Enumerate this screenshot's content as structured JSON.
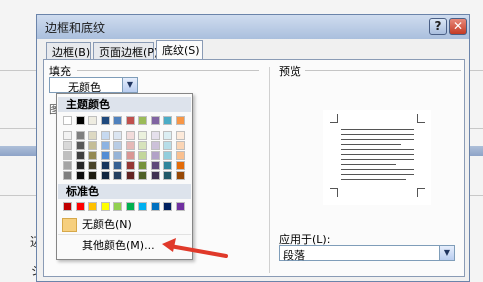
{
  "dialog": {
    "title": "边框和底纹",
    "help_label": "?",
    "close_label": "✕"
  },
  "tabs": [
    {
      "label": "边框(B)"
    },
    {
      "label": "页面边框(P)"
    },
    {
      "label": "底纹(S)"
    }
  ],
  "shading": {
    "fill_label": "填充",
    "fill_value": "无颜色",
    "pattern_label_partial": "图"
  },
  "preview": {
    "label": "预览"
  },
  "apply": {
    "label": "应用于(L):",
    "value": "段落"
  },
  "color_menu": {
    "theme_colors_label": "主题颜色",
    "standard_colors_label": "标准色",
    "no_color_label": "无颜色(N)",
    "more_colors_label": "其他颜色(M)...",
    "theme_top_row": [
      "#ffffff",
      "#000000",
      "#eeece1",
      "#1f497d",
      "#4f81bd",
      "#c0504d",
      "#9bbb59",
      "#8064a2",
      "#4bacc6",
      "#f79646"
    ],
    "theme_shades": [
      [
        "#f2f2f2",
        "#7f7f7f",
        "#ddd9c3",
        "#c6d9f0",
        "#dbe5f1",
        "#f2dcdb",
        "#ebf1dd",
        "#e5e0ec",
        "#dbeef3",
        "#fdeada"
      ],
      [
        "#d8d8d8",
        "#595959",
        "#c4bd97",
        "#8db3e2",
        "#b8cce4",
        "#e5b9b7",
        "#d7e3bc",
        "#ccc1d9",
        "#b7dde8",
        "#fbd5b5"
      ],
      [
        "#bfbfbf",
        "#3f3f3f",
        "#938953",
        "#548dd4",
        "#95b3d7",
        "#d99694",
        "#c3d69b",
        "#b2a2c7",
        "#92cddc",
        "#fac08f"
      ],
      [
        "#a5a5a5",
        "#262626",
        "#494429",
        "#17365d",
        "#366092",
        "#953734",
        "#76923c",
        "#5f497a",
        "#31859b",
        "#e36c09"
      ],
      [
        "#7f7f7f",
        "#0c0c0c",
        "#1d1b10",
        "#0f243e",
        "#244061",
        "#632423",
        "#4f6128",
        "#3f3151",
        "#205867",
        "#974806"
      ]
    ],
    "standard": [
      "#c00000",
      "#ff0000",
      "#ffc000",
      "#ffff00",
      "#92d050",
      "#00b050",
      "#00b0f0",
      "#0070c0",
      "#002060",
      "#7030a0"
    ]
  },
  "background": {
    "char1": "辺",
    "char2": "ジ"
  }
}
